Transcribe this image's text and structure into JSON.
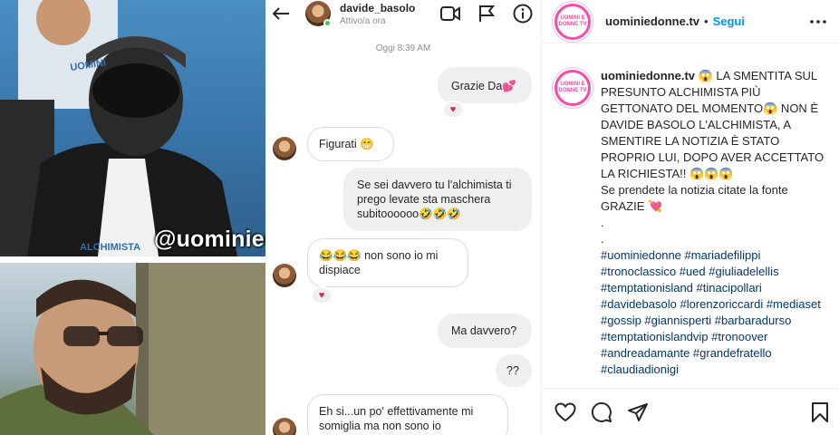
{
  "post_image": {
    "watermark": "@uominiedonne.tv",
    "shirt_text_top": "UOMINI",
    "shirt_text_bottom": "ALCHIMISTA"
  },
  "dm": {
    "username": "davide_basolo",
    "status": "Attivo/a ora",
    "timestamp": "Oggi 8:39 AM",
    "messages": [
      {
        "from": "me",
        "text": "Grazie Da💕",
        "reaction": "♥"
      },
      {
        "from": "them",
        "text": "Figurati 😁"
      },
      {
        "from": "me",
        "text": "Se sei davvero tu l'alchimista ti prego levate sta maschera subitoooooo🤣🤣🤣"
      },
      {
        "from": "them",
        "text": "😂😂😂 non sono io mi dispiace",
        "reaction": "♥"
      },
      {
        "from": "me",
        "text": "Ma davvero?"
      },
      {
        "from": "me",
        "text": "??"
      },
      {
        "from": "them",
        "text": "Eh si...un po' effettivamente mi somiglia ma non sono io"
      }
    ]
  },
  "panel": {
    "username": "uominiedonne.tv",
    "separator": "•",
    "follow_label": "Segui",
    "avatar_text": "UOMINI E DONNE TV",
    "caption": {
      "username": "uominiedonne.tv",
      "text": "😱 LA SMENTITA SUL PRESUNTO ALCHIMISTA PIÙ GETTONATO DEL MOMENTO😱 NON È DAVIDE BASOLO L'ALCHIMISTA, A SMENTIRE LA NOTIZIA È STATO PROPRIO LUI, DOPO AVER ACCETTATO LA RICHIESTA!! 😱😱😱",
      "line2": "Se prendete la notizia citate la fonte GRAZIE 💘",
      "dot1": ".",
      "dot2": ".",
      "hashtags": "#uominiedonne #mariadefilippi #tronoclassico #ued #giuliadelellis #temptationisland #tinacipollari #davidebasolo #lorenzoriccardi #mediaset #gossip #giannisperti #barbaradurso #temptationislandvip #tronoover #andreadamante #grandefratello #claudiadionigi"
    }
  },
  "colors": {
    "accent": "#0095f6",
    "hashtag": "#00376b",
    "brand_pink": "#f54da8",
    "heart_red": "#e0245e"
  },
  "icons": [
    "back-arrow-icon",
    "video-call-icon",
    "flag-icon",
    "info-icon",
    "more-options-icon",
    "heart-icon",
    "comment-icon",
    "share-icon",
    "bookmark-icon"
  ]
}
